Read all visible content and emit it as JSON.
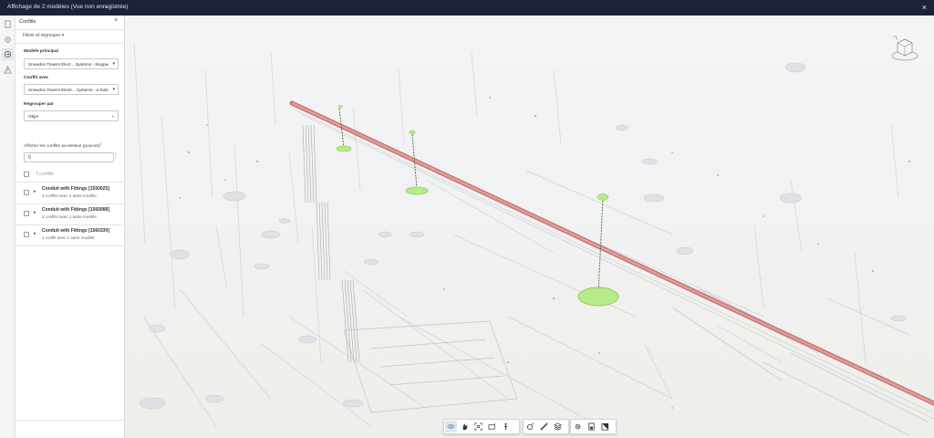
{
  "window": {
    "title": "Affichage de 2 modèles (Vue non enregistrée)",
    "chevron_icon": "chevron-down-icon",
    "close_icon": "close-icon"
  },
  "rail": {
    "items": [
      {
        "icon": "document-icon",
        "active": false
      },
      {
        "icon": "layers-icon",
        "active": false
      },
      {
        "icon": "compare-icon",
        "active": true
      },
      {
        "icon": "warning-icon",
        "active": false
      }
    ]
  },
  "panel": {
    "title": "Conflits",
    "filter_label": "Filtrer et regrouper",
    "main_model_label": "Modèle principal",
    "main_model_value": "Snowdon Towers Elect... Systems - Skipped",
    "conflict_with_label": "Conflit avec",
    "conflict_with_value": "Snowdon Towers Electr... Systems - w building",
    "group_by_label": "Regrouper par",
    "group_by_value": "Objet",
    "threshold_label": "Afficher les conflits au-dessus (pouces)",
    "threshold_value": "0",
    "count_label": "7 conflits",
    "items": [
      {
        "title": "Conduit with Fittings [1550025]",
        "subtitle": "3 conflits avec 1 autre modèle"
      },
      {
        "title": "Conduit with Fittings [1560088]",
        "subtitle": "3 conflits avec 1 autre modèle"
      },
      {
        "title": "Conduit with Fittings [1560330]",
        "subtitle": "1 conflit avec 1 autre modèle"
      }
    ]
  },
  "toolbar": {
    "groups": [
      [
        "orbit-icon",
        "pan-icon",
        "fit-to-view-icon",
        "camera-icon",
        "first-person-icon"
      ],
      [
        "explode-icon",
        "measure-icon",
        "section-icon"
      ],
      [
        "settings-icon",
        "properties-icon",
        "model-browser-icon"
      ]
    ],
    "active": "orbit-icon"
  },
  "colors": {
    "topbar": "#1d2238",
    "accent_green": "#8fdd4a",
    "pipe_red": "#d47c78"
  }
}
